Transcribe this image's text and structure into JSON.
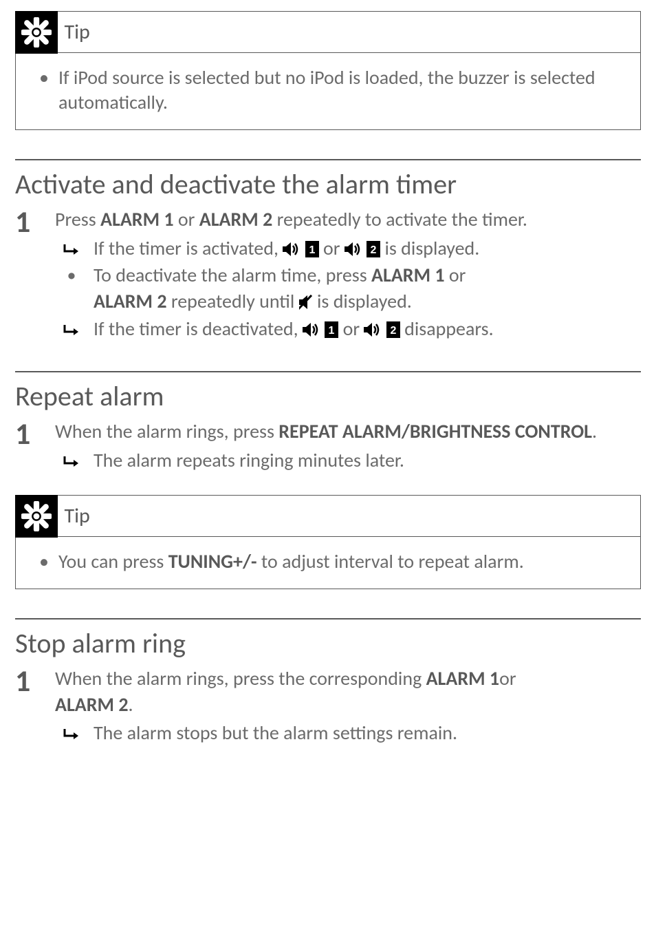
{
  "tip1": {
    "label": "Tip",
    "body": "If iPod source is selected but no iPod is loaded, the buzzer is selected automatically."
  },
  "section1": {
    "heading": "Activate and deactivate the alarm timer",
    "step_num": "1",
    "main_a": "Press ",
    "main_b": "ALARM 1",
    "main_c": " or ",
    "main_d": "ALARM 2",
    "main_e": " repeatedly to activate the timer.",
    "sub1_a": "If the timer is activated, ",
    "sub1_b": " or ",
    "sub1_c": " is displayed.",
    "sub2_a": "To deactivate the alarm time, press ",
    "sub2_b": "ALARM 1",
    "sub2_c": " or ",
    "sub2_d": "ALARM 2",
    "sub2_e": " repeatedly until ",
    "sub2_f": " is displayed.",
    "sub3_a": "If the timer is deactivated, ",
    "sub3_b": " or ",
    "sub3_c": " disappears."
  },
  "section2": {
    "heading": "Repeat alarm",
    "step_num": "1",
    "main_a": "When the alarm rings, press ",
    "main_b": "REPEAT ALARM/BRIGHTNESS CONTROL",
    "main_c": ".",
    "sub1": "The alarm repeats ringing minutes later."
  },
  "tip2": {
    "label": "Tip",
    "body_a": "You can press ",
    "body_b": "TUNING+/-",
    "body_c": " to adjust interval to repeat alarm."
  },
  "section3": {
    "heading": "Stop alarm ring",
    "step_num": "1",
    "main_a": "When the alarm rings, press the corresponding ",
    "main_b": "ALARM 1",
    "main_c": "or ",
    "main_d": "ALARM 2",
    "main_e": ".",
    "sub1": "The alarm stops but the alarm settings remain."
  }
}
